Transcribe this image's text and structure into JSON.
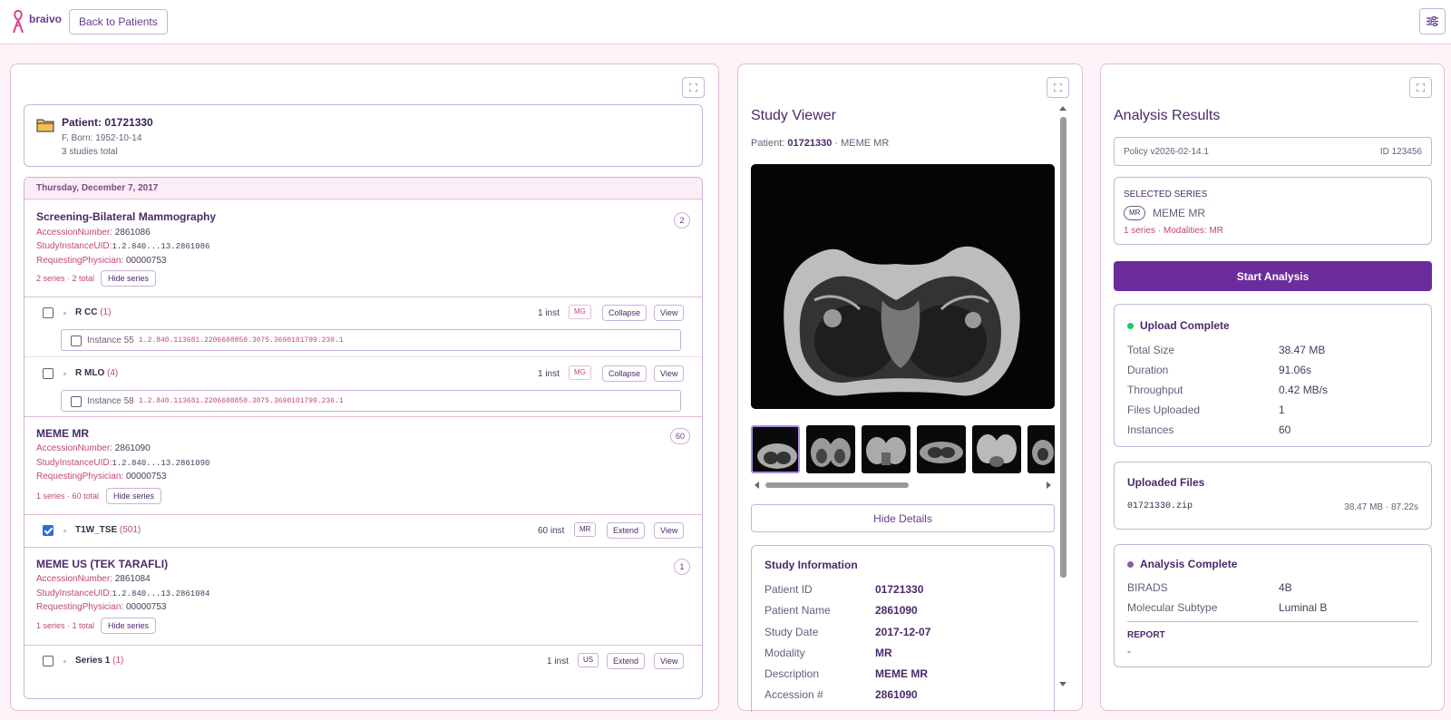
{
  "app": {
    "brand": "braivo",
    "back_label": "Back to Patients"
  },
  "patient": {
    "title": "Patient: 01721330",
    "born": "F, Born: 1952-10-14",
    "studies_total": "3 studies total"
  },
  "study_list": {
    "date": "Thursday, December 7, 2017",
    "studies": [
      {
        "title": "Screening-Bilateral Mammography",
        "accession_label": "AccessionNumber:",
        "accession": "2861086",
        "uid_label": "StudyInstanceUID:",
        "uid": "1.2.840...13.2861086",
        "phys_label": "RequestingPhysician:",
        "phys": "00000753",
        "count": "2",
        "series_count": "2 series · 2 total",
        "hide_label": "Hide series",
        "series": [
          {
            "name": "R CC",
            "num": "(1)",
            "inst": "1 inst",
            "modality": "MG",
            "action": "Collapse",
            "view": "View",
            "instance_label": "Instance 55",
            "instance_uid": "1.2.840.113681.2206608850.3075.3690101799.230.1"
          },
          {
            "name": "R MLO",
            "num": "(4)",
            "inst": "1 inst",
            "modality": "MG",
            "action": "Collapse",
            "view": "View",
            "instance_label": "Instance 58",
            "instance_uid": "1.2.840.113681.2206608850.3075.3690101799.236.1"
          }
        ]
      },
      {
        "title": "MEME MR",
        "accession_label": "AccessionNumber:",
        "accession": "2861090",
        "uid_label": "StudyInstanceUID:",
        "uid": "1.2.840...13.2861090",
        "phys_label": "RequestingPhysician:",
        "phys": "00000753",
        "count": "60",
        "series_count": "1 series · 60 total",
        "hide_label": "Hide series",
        "series": [
          {
            "name": "T1W_TSE",
            "num": "(501)",
            "inst": "60 inst",
            "modality": "MR",
            "action": "Extend",
            "view": "View",
            "checked": true
          }
        ]
      },
      {
        "title": "MEME US (TEK TARAFLI)",
        "accession_label": "AccessionNumber:",
        "accession": "2861084",
        "uid_label": "StudyInstanceUID:",
        "uid": "1.2.840...13.2861084",
        "phys_label": "RequestingPhysician:",
        "phys": "00000753",
        "count": "1",
        "series_count": "1 series · 1 total",
        "hide_label": "Hide series",
        "series": [
          {
            "name": "Series 1",
            "num": "(1)",
            "inst": "1 inst",
            "modality": "US",
            "action": "Extend",
            "view": "View"
          }
        ]
      }
    ]
  },
  "viewer": {
    "title": "Study Viewer",
    "patient_label": "Patient:",
    "patient_id": "01721330",
    "study_suffix": "· MEME MR",
    "hide_details": "Hide Details",
    "info_title": "Study Information",
    "info": [
      {
        "label": "Patient ID",
        "value": "01721330"
      },
      {
        "label": "Patient Name",
        "value": "2861090"
      },
      {
        "label": "Study Date",
        "value": "2017-12-07"
      },
      {
        "label": "Modality",
        "value": "MR"
      },
      {
        "label": "Description",
        "value": "MEME MR"
      },
      {
        "label": "Accession #",
        "value": "2861090"
      }
    ]
  },
  "analysis": {
    "title": "Analysis Results",
    "policy": "Policy v2026-02-14.1",
    "policy_id": "ID 123456",
    "selected_caption": "SELECTED SERIES",
    "selected_modality": "MR",
    "selected_name": "MEME MR",
    "selected_sub": "1 series · Modalities: MR",
    "start_label": "Start Analysis",
    "upload_title": "Upload Complete",
    "upload": [
      {
        "label": "Total Size",
        "value": "38.47 MB"
      },
      {
        "label": "Duration",
        "value": "91.06s"
      },
      {
        "label": "Throughput",
        "value": "0.42 MB/s"
      },
      {
        "label": "Files Uploaded",
        "value": "1"
      },
      {
        "label": "Instances",
        "value": "60"
      }
    ],
    "files_title": "Uploaded Files",
    "file_name": "01721330.zip",
    "file_meta": "38.47 MB · 87.22s",
    "complete_title": "Analysis Complete",
    "results": [
      {
        "label": "BIRADS",
        "value": "4B"
      },
      {
        "label": "Molecular Subtype",
        "value": "Luminal B"
      }
    ],
    "report_caption": "REPORT",
    "report_value": "-"
  },
  "colors": {
    "accent": "#6b2d9c",
    "upload_dot": "#22c55e",
    "complete_dot": "#8a5aa8"
  }
}
